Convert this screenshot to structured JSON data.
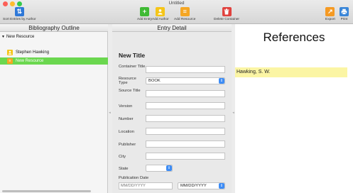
{
  "window": {
    "title": "Untitled"
  },
  "toolbar": {
    "sort_label": "Sort Entries by Author",
    "add_entry_label": "Add Entry",
    "add_author_label": "Add Author",
    "add_resource_label": "Add Resource",
    "delete_container_label": "Delete Container",
    "export_label": "Export",
    "print_label": "Print"
  },
  "outline": {
    "header": "Bibliography Outline",
    "root": {
      "label": "New Resource"
    },
    "items": [
      {
        "label": "Stephen Hawking",
        "icon": "person-icon",
        "selected": false
      },
      {
        "label": "New Resource",
        "icon": "resource-icon",
        "selected": true
      }
    ]
  },
  "detail": {
    "header": "Entry Detail",
    "title": "New Title",
    "labels": {
      "container_title": "Container Title",
      "resource_type": "Resource Type",
      "source_title": "Source Title",
      "version": "Version",
      "number": "Number",
      "location": "Location",
      "publisher": "Publisher",
      "city": "City",
      "state": "State",
      "publication_date": "Publication Date"
    },
    "resource_type_value": "BOOK",
    "date_placeholder": "MM/DD/YYYY",
    "date_select_value": "MM/DD/YYYY"
  },
  "references": {
    "title": "References",
    "entries": [
      "Hawking, S. W."
    ]
  },
  "colors": {
    "accent_green": "#6bd74f",
    "sort_blue": "#2e78d8",
    "add_green": "#3fba34",
    "author_yellow": "#f5c518",
    "resource_orange": "#f5a623",
    "delete_red": "#e0423e",
    "export_orange": "#f59a23",
    "print_blue": "#3a86d8",
    "reference_highlight": "#fbf5a4"
  }
}
